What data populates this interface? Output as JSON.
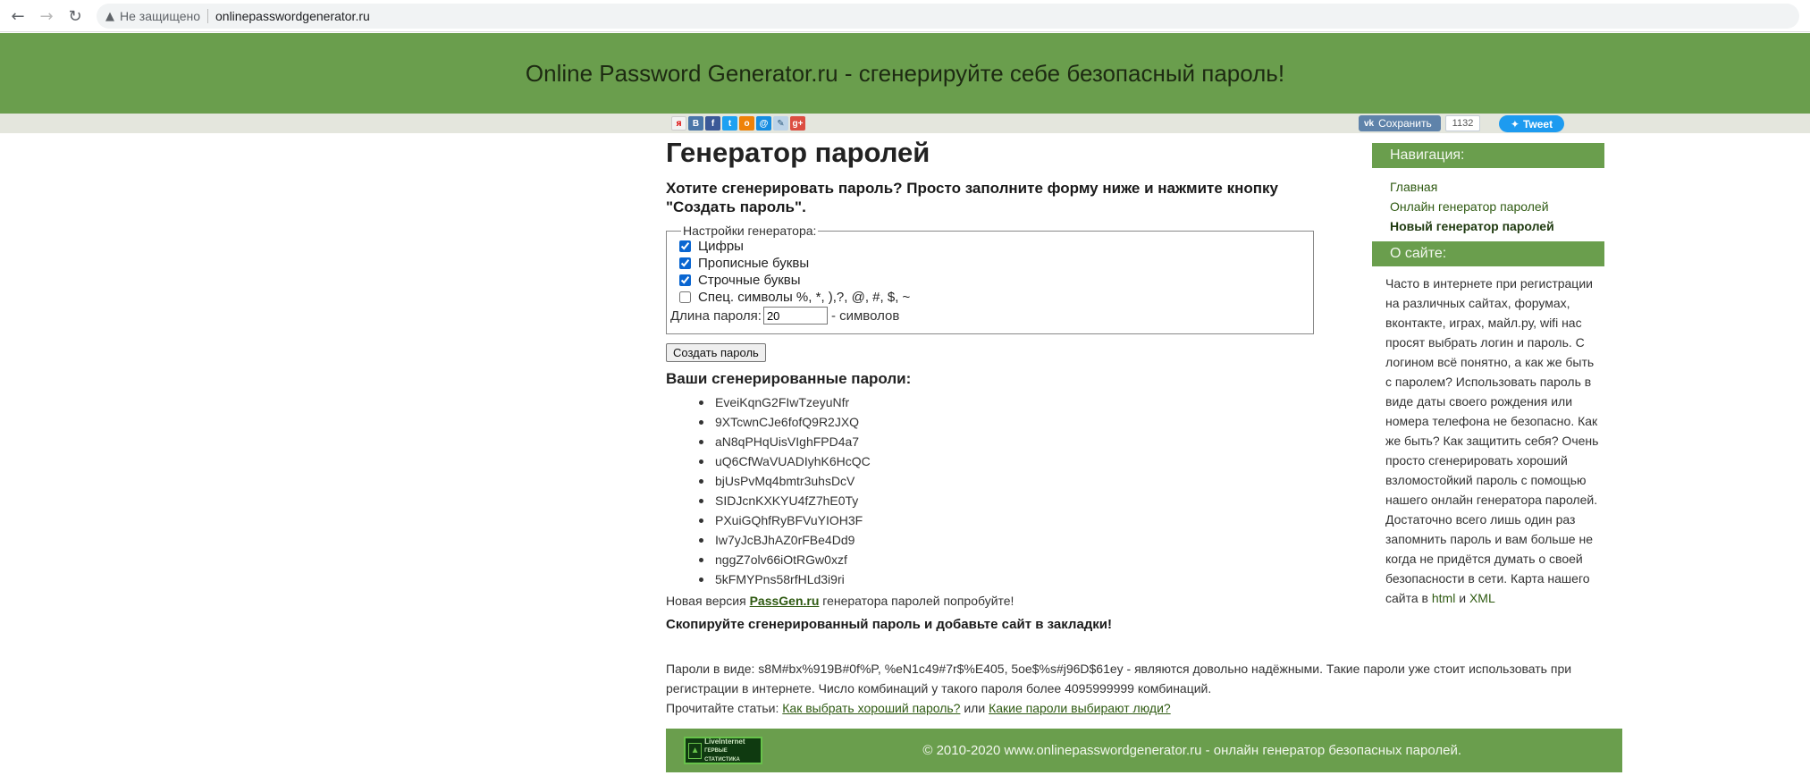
{
  "browser": {
    "security_label": "Не защищено",
    "url": "onlinepasswordgenerator.ru"
  },
  "header": {
    "title": "Online Password Generator.ru - сгенерируйте себе безопасный пароль!"
  },
  "share": {
    "icons": [
      "yandex-share-icon",
      "vkontakte-share-icon",
      "facebook-share-icon",
      "twitter-share-icon",
      "odnoklassniki-share-icon",
      "mailru-share-icon",
      "livejournal-share-icon",
      "google-plus-share-icon"
    ],
    "vk_save_label": "Сохранить",
    "vk_count": "1132",
    "tweet_label": "Tweet"
  },
  "main": {
    "title": "Генератор паролей",
    "lead": "Хотите сгенерировать пароль? Просто заполните форму ниже и нажмите кнопку \"Создать пароль\".",
    "settings": {
      "legend": "Настройки генератора:",
      "options": [
        {
          "label": "Цифры",
          "checked": true
        },
        {
          "label": "Прописные буквы",
          "checked": true
        },
        {
          "label": "Строчные буквы",
          "checked": true
        },
        {
          "label": "Спец. символы %, *, ),?, @, #, $, ~",
          "checked": false
        }
      ],
      "length_label": "Длина пароля:",
      "length_value": "20",
      "length_suffix": "- символов"
    },
    "generate_button": "Создать пароль",
    "results_title": "Ваши сгенерированные пароли:",
    "passwords": [
      "EveiKqnG2FIwTzeyuNfr",
      "9XTcwnCJe6fofQ9R2JXQ",
      "aN8qPHqUisVIghFPD4a7",
      "uQ6CfWaVUADIyhK6HcQC",
      "bjUsPvMq4bmtr3uhsDcV",
      "SIDJcnKXKYU4fZ7hE0Ty",
      "PXuiGQhfRyBFVuYIOH3F",
      "Iw7yJcBJhAZ0rFBe4Dd9",
      "nggZ7olv66iOtRGw0xzf",
      "5kFMYPns58rfHLd3i9ri"
    ],
    "new_version_prefix": "Новая версия",
    "new_version_link": "PassGen.ru",
    "new_version_suffix": "генератора паролей попробуйте!",
    "copy_note": "Скопируйте сгенерированный пароль и добавьте сайт в закладки!",
    "info_text": "Пароли в виде: s8M#bx%919B#0f%P, %eN1c49#7r$%E405, 5oe$%s#j96D$61ey - являются довольно надёжными. Такие пароли уже стоит использовать при регистрации в интернете. Число комбинаций у такого пароля более 4095999999 комбинаций.",
    "read_prefix": "Прочитайте статьи:",
    "article1": "Как выбрать хороший пароль?",
    "read_or": "или",
    "article2": "Какие пароли выбирают люди?"
  },
  "footer": {
    "badge_line1": "LiveInternet",
    "badge_line2": "ГЕРВЫЕ СТАТИСТИКА",
    "text": "© 2010-2020 www.onlinepasswordgenerator.ru - онлайн генератор безопасных паролей."
  },
  "sidebar": {
    "nav_title": "Навигация:",
    "nav_items": [
      "Главная",
      "Онлайн генератор паролей",
      "Новый генератор паролей"
    ],
    "about_title": "О сайте:",
    "about_text": "Часто в интернете при регистрации на различных сайтах, форумах, вконтакте, играх, майл.ру, wifi нас просят выбрать логин и пароль. С логином всё понятно, а как же быть с паролем? Использовать пароль в виде даты своего рождения или номера телефона не безопасно. Как же быть? Как защитить себя? Очень просто сгенерировать хороший взломостойкий пароль с помощью нашего онлайн генератора паролей. Достаточно всего лишь один раз запомнить пароль и вам больше не когда не придётся думать о своей безопасности в сети. Карта нашего сайта в",
    "about_link_html": "html",
    "about_and": "и",
    "about_link_xml": "XML"
  }
}
